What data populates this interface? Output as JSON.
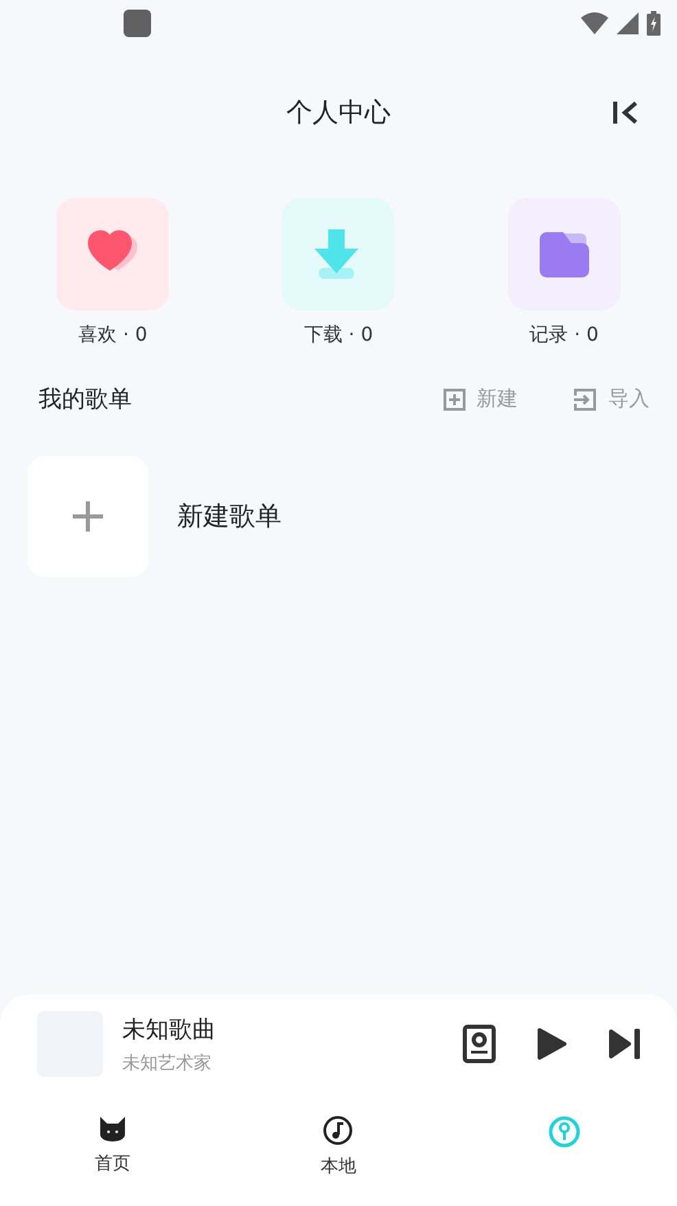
{
  "header": {
    "title": "个人中心"
  },
  "shortcuts": [
    {
      "label": "喜欢 · 0"
    },
    {
      "label": "下载 · 0"
    },
    {
      "label": "记录 · 0"
    }
  ],
  "playlists": {
    "title": "我的歌单",
    "actions": [
      {
        "label": "新建"
      },
      {
        "label": "导入"
      }
    ],
    "create_label": "新建歌单"
  },
  "player": {
    "song": "未知歌曲",
    "artist": "未知艺术家"
  },
  "nav": [
    {
      "label": "首页",
      "selected": false
    },
    {
      "label": "本地",
      "selected": false
    },
    {
      "selected": true
    }
  ]
}
